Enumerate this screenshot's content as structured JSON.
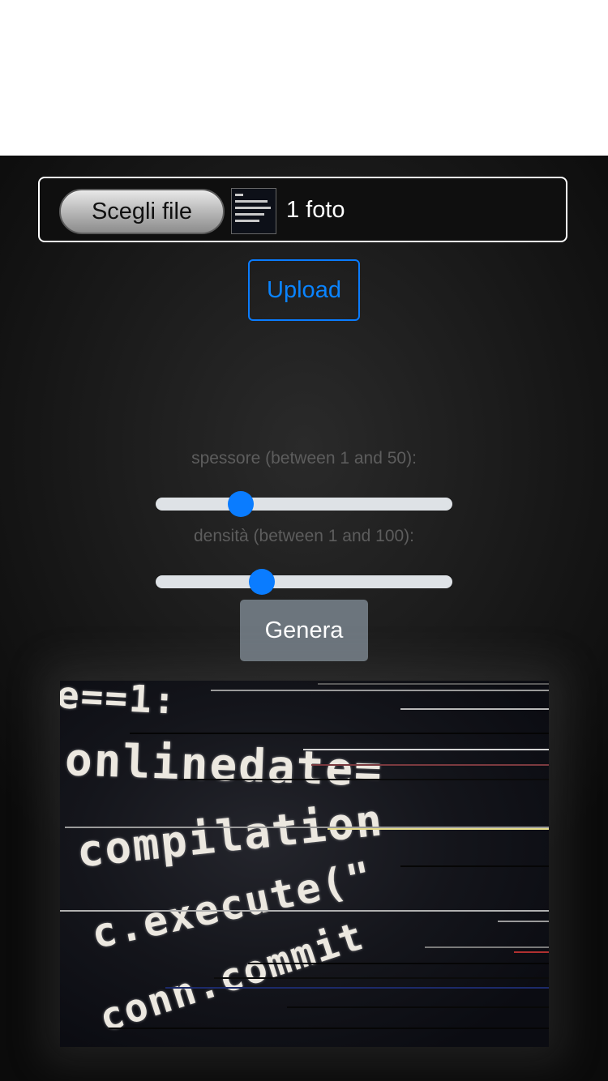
{
  "file_picker": {
    "choose_label": "Scegli file",
    "count_label": "1 foto",
    "thumbnail_icon": "code-photo-thumbnail"
  },
  "upload": {
    "label": "Upload"
  },
  "controls": {
    "thickness": {
      "label": "spessore (between 1 and 50):",
      "min": 1,
      "max": 50,
      "value": 14
    },
    "density": {
      "label": "densità (between 1 and 100):",
      "min": 1,
      "max": 100,
      "value": 35
    }
  },
  "generate": {
    "label": "Genera"
  },
  "result": {
    "code_lines": [
      "e==1:",
      "onlinedate=",
      "compilation",
      "c.execute(\"",
      "conn.commit"
    ]
  },
  "colors": {
    "accent": "#0a7cff",
    "secondary_button": "#6c757d",
    "track": "#dee2e6",
    "label": "#5d5d5d"
  }
}
